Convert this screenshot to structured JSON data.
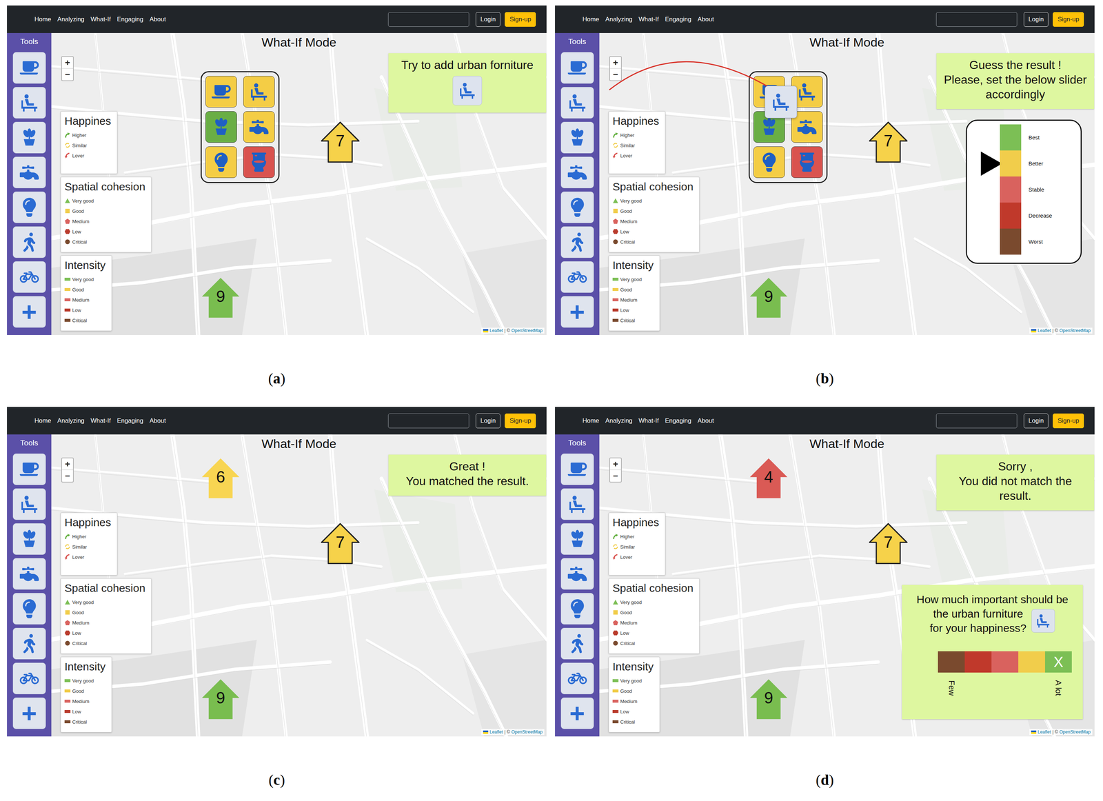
{
  "screen": {
    "nav": {
      "links": [
        "Home",
        "Analyzing",
        "What-If",
        "Engaging",
        "About"
      ],
      "search": {
        "value": ""
      },
      "buttons": [
        {
          "label": "Login",
          "kind": "outline"
        },
        {
          "label": "Sign-up",
          "kind": "primary"
        }
      ]
    },
    "tools": {
      "title": "Tools",
      "add": "+"
    },
    "title": "What-If Mode",
    "zoom": {
      "in": "+",
      "out": "−"
    },
    "legends": [
      {
        "title": "Happines",
        "items": [
          {
            "label": "Higher",
            "kind": "up",
            "color": "#5fae3b"
          },
          {
            "label": "Similar",
            "kind": "same",
            "color": "#f0c93a"
          },
          {
            "label": "Lover",
            "kind": "down",
            "color": "#d9534f"
          }
        ]
      },
      {
        "title": "Spatial cohesion",
        "items": [
          {
            "label": "Very good",
            "kind": "triangle",
            "color": "#7cbf55"
          },
          {
            "label": "Good",
            "kind": "square",
            "color": "#f1cd4b"
          },
          {
            "label": "Medium",
            "kind": "pentagon",
            "color": "#d9625e"
          },
          {
            "label": "Low",
            "kind": "hexagon",
            "color": "#b93a2b"
          },
          {
            "label": "Critical",
            "kind": "circle",
            "color": "#7a4a2e"
          }
        ]
      },
      {
        "title": "Intensity",
        "items": [
          {
            "label": "Very good",
            "kind": "bar",
            "color": "#7cbf55"
          },
          {
            "label": "Good",
            "kind": "bar",
            "color": "#f1cd4b"
          },
          {
            "label": "Medium",
            "kind": "bar",
            "color": "#d9625e"
          },
          {
            "label": "Low",
            "kind": "bar",
            "color": "#b93a2b"
          },
          {
            "label": "Critical",
            "kind": "bar",
            "color": "#7a4a2e"
          }
        ]
      }
    ],
    "tiles": [
      {
        "color": "#f4cd45"
      },
      {
        "color": "#f4cd45"
      },
      {
        "color": "#6aae45"
      },
      {
        "color": "#f4cd45"
      },
      {
        "color": "#f4cd45"
      },
      {
        "color": "#d9534f"
      }
    ],
    "attribution": [
      "Leaflet",
      "| ©",
      "OpenStreetMap"
    ]
  },
  "panels": [
    {
      "caption": [
        "(",
        "a",
        ")"
      ],
      "message": {
        "lines": [
          "Try to add urban forniture"
        ],
        "show_icon": true
      },
      "tile_popup_open": true,
      "dragging": false,
      "houses": [
        {
          "value": "7",
          "color": "#f6d24a",
          "kind": "center",
          "outlined": true
        },
        {
          "value": "9",
          "color": "#79bd4f",
          "kind": "south",
          "outlined": false
        }
      ]
    },
    {
      "caption": [
        "(",
        "b",
        ")"
      ],
      "message": {
        "lines": [
          "Guess the result !",
          "Please, set the below slider",
          "accordingly"
        ],
        "show_icon": false
      },
      "tile_popup_open": true,
      "dragging": true,
      "houses": [
        {
          "value": "7",
          "color": "#f6d24a",
          "kind": "center",
          "outlined": true
        },
        {
          "value": "9",
          "color": "#79bd4f",
          "kind": "south",
          "outlined": false
        }
      ],
      "guess_slider": {
        "levels": [
          {
            "label": "Best",
            "color": "#7cbf55",
            "selected": false
          },
          {
            "label": "Better",
            "color": "#f1cd4b",
            "selected": true
          },
          {
            "label": "Stable",
            "color": "#d9625e",
            "selected": false
          },
          {
            "label": "Decrease",
            "color": "#c0392b",
            "selected": false
          },
          {
            "label": "Worst",
            "color": "#7a4a2e",
            "selected": false
          }
        ]
      }
    },
    {
      "caption": [
        "(",
        "c",
        ")"
      ],
      "message": {
        "lines": [
          "Great !",
          "You matched the result."
        ],
        "show_icon": false
      },
      "tile_popup_open": false,
      "dragging": false,
      "houses": [
        {
          "value": "6",
          "color": "#f8d552",
          "kind": "added",
          "outlined": false
        },
        {
          "value": "7",
          "color": "#f6d24a",
          "kind": "center",
          "outlined": true
        },
        {
          "value": "9",
          "color": "#79bd4f",
          "kind": "south",
          "outlined": false
        }
      ]
    },
    {
      "caption": [
        "(",
        "d",
        ")"
      ],
      "message": {
        "lines": [
          "Sorry ,",
          "You did not match the result."
        ],
        "show_icon": false
      },
      "tile_popup_open": false,
      "dragging": false,
      "houses": [
        {
          "value": "4",
          "color": "#da5a55",
          "kind": "added",
          "outlined": false
        },
        {
          "value": "7",
          "color": "#f6d24a",
          "kind": "center",
          "outlined": true
        },
        {
          "value": "9",
          "color": "#79bd4f",
          "kind": "south",
          "outlined": false
        }
      ],
      "importance": {
        "lines": [
          "How much important should be",
          "the urban furniture",
          "for your happiness?"
        ],
        "scale": [
          {
            "color": "#7a4a2e",
            "selected": false
          },
          {
            "color": "#c0392b",
            "selected": false
          },
          {
            "color": "#d9625e",
            "selected": false
          },
          {
            "color": "#f1cd4b",
            "selected": false
          },
          {
            "color": "#7cbf55",
            "selected": true
          }
        ],
        "selected_mark": "X",
        "low": "Few",
        "high": "A lot"
      }
    }
  ]
}
